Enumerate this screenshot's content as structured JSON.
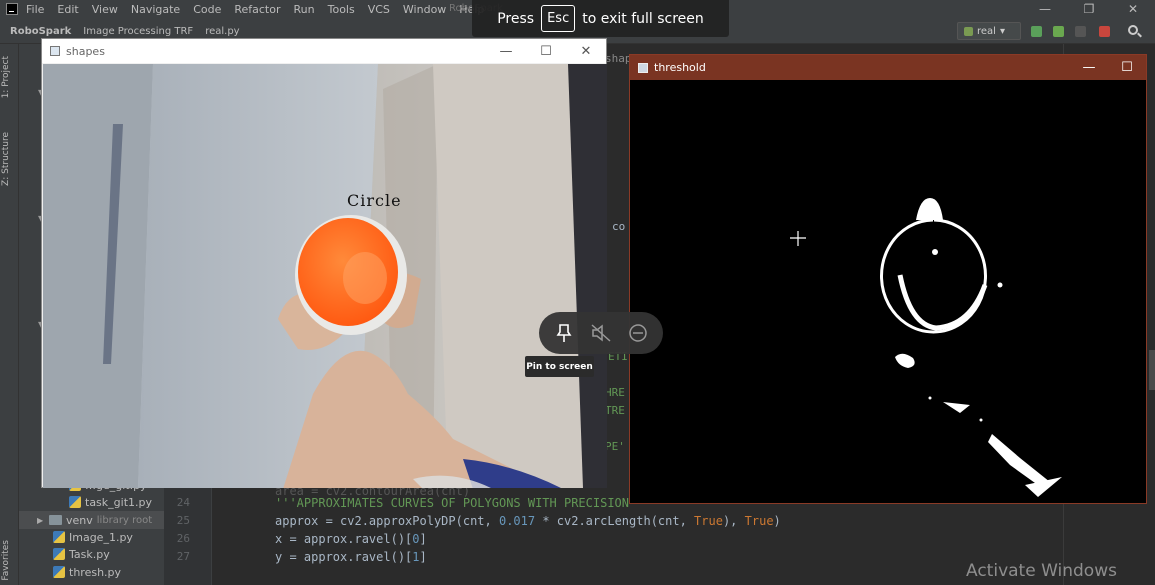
{
  "ide": {
    "menu": [
      "File",
      "Edit",
      "View",
      "Navigate",
      "Code",
      "Refactor",
      "Run",
      "Tools",
      "VCS",
      "Window",
      "Help"
    ],
    "title": "RoboSpark",
    "breadcrumbs": [
      "RoboSpark",
      "Image Processing TRF",
      "real.py"
    ],
    "run_config": "real",
    "window_controls": [
      "—",
      "❐",
      "✕"
    ]
  },
  "tool_tabs": [
    "1: Project",
    "Z: Structure",
    "Favorites"
  ],
  "project_tree": {
    "items": [
      {
        "label": "task_git1.py",
        "type": "file"
      },
      {
        "label": "venv",
        "suffix": "library root",
        "type": "folder"
      },
      {
        "label": "Image_1.py",
        "type": "file"
      },
      {
        "label": "Task.py",
        "type": "file"
      },
      {
        "label": "thresh.py",
        "type": "file"
      }
    ],
    "partial_label": "…ge_git.py"
  },
  "editor": {
    "line_numbers": [
      "24",
      "25",
      "26",
      "27"
    ],
    "lines": {
      "comment": "'''APPROXIMATES CURVES OF POLYGONS WITH PRECISION'''",
      "approx_prefix": "approx = cv2.approxPolyDP(cnt, ",
      "approx_num": "0.017",
      "approx_mid": " * cv2.arcLength(cnt, ",
      "approx_true1": "True",
      "approx_close1": "), ",
      "approx_true2": "True",
      "approx_close2": ")",
      "x_prefix": "x = approx.ravel()[",
      "x_idx": "0",
      "x_close": "]",
      "y_prefix": "y = approx.ravel()[",
      "y_idx": "1",
      "y_close": "]"
    },
    "fragments": {
      "co": "co",
      "eti": "ETI",
      "hre": "HRE",
      "tre": "TRE",
      "pe": "PE'",
      "area": "area = cv2.contourArea(cnt)",
      "shap": "shap"
    }
  },
  "shapes_window": {
    "title": "shapes",
    "detected_label": "Circle"
  },
  "threshold_window": {
    "title": "threshold"
  },
  "fullscreen_hint": {
    "press": "Press",
    "key": "Esc",
    "rest": "to exit full screen"
  },
  "pip_controls": {
    "tooltip": "Pin to screen",
    "buttons": [
      "pin-icon",
      "mute-icon",
      "minimize-icon"
    ]
  },
  "watermark": "Activate Windows",
  "colors": {
    "ide_bg": "#2b2b2b",
    "panel_bg": "#3c3f41",
    "threshold_titlebar": "#7a3422",
    "cup_orange": "#ff6a1f"
  }
}
